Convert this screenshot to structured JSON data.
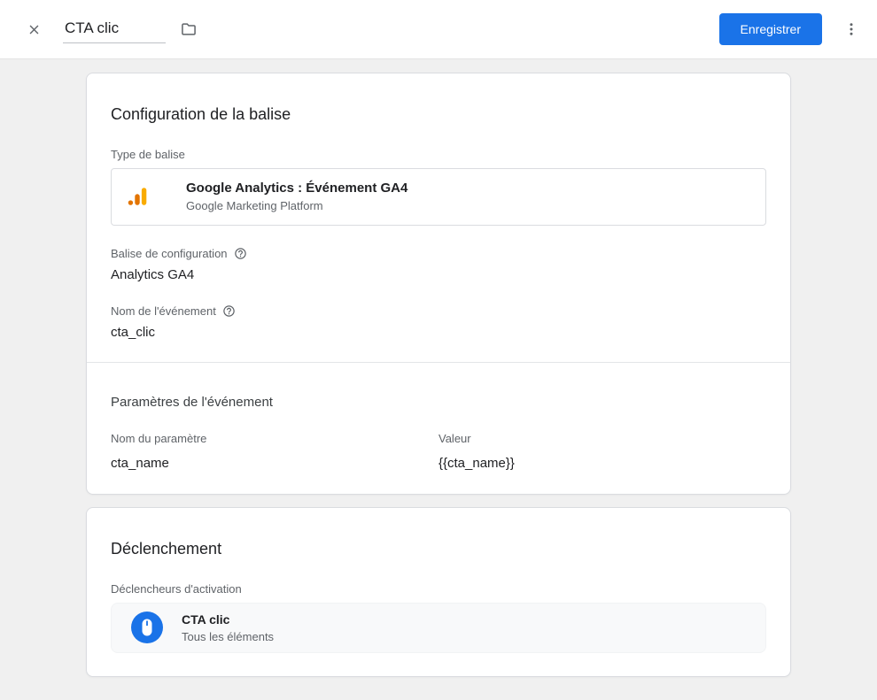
{
  "header": {
    "tag_name_value": "CTA clic",
    "save_button_label": "Enregistrer"
  },
  "icons": {
    "close": "close-x",
    "folder": "folder-outline",
    "more": "kebab-vertical-dots",
    "help": "question-mark-circle",
    "tag_type": "google-analytics-bars",
    "trigger": "mouse-click-blue-circle"
  },
  "tag_config": {
    "title": "Configuration de la balise",
    "type_label": "Type de balise",
    "type_name": "Google Analytics : Événement GA4",
    "type_platform": "Google Marketing Platform",
    "config_tag_label": "Balise de configuration",
    "config_tag_value": "Analytics GA4",
    "event_name_label": "Nom de l'événement",
    "event_name_value": "cta_clic",
    "params": {
      "title": "Paramètres de l'événement",
      "name_header": "Nom du paramètre",
      "value_header": "Valeur",
      "rows": [
        {
          "name": "cta_name",
          "value": "{{cta_name}}"
        }
      ]
    }
  },
  "trigger_card": {
    "title": "Déclenchement",
    "label": "Déclencheurs d'activation",
    "trigger_name": "CTA clic",
    "trigger_type": "Tous les éléments"
  }
}
